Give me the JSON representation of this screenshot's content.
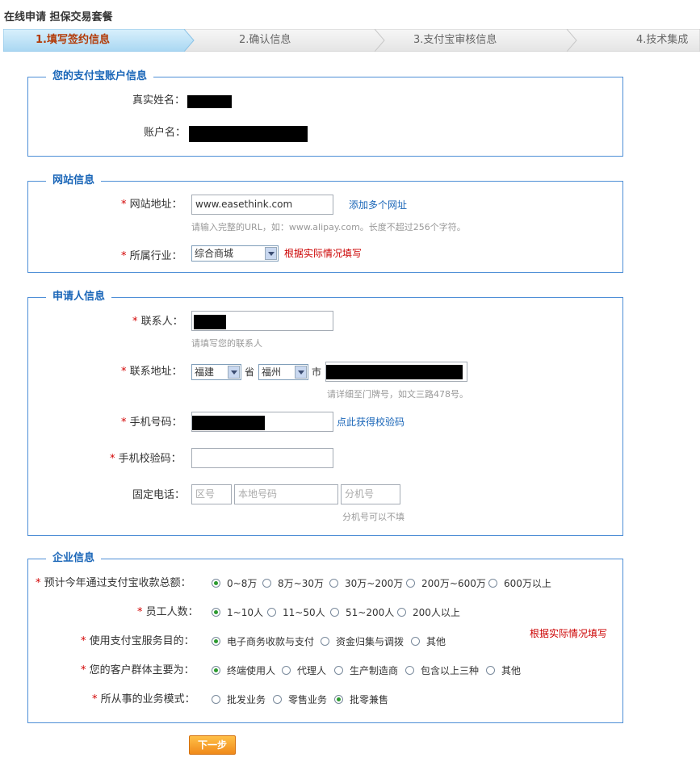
{
  "page": {
    "title": "在线申请 担保交易套餐"
  },
  "steps": [
    {
      "label": "1.填写签约信息"
    },
    {
      "label": "2.确认信息"
    },
    {
      "label": "3.支付宝审核信息"
    },
    {
      "label": "4.技术集成"
    }
  ],
  "account": {
    "legend": "您的支付宝账户信息",
    "realname_label": "真实姓名：",
    "account_label": "账户名："
  },
  "site": {
    "legend": "网站信息",
    "url_label": "网站地址：",
    "url_value": "www.easethink.com",
    "add_more": "添加多个网址",
    "url_hint": "请输入完整的URL，如：www.alipay.com。长度不超过256个字符。",
    "industry_label": "所属行业：",
    "industry_value": "综合商城",
    "industry_note": "根据实际情况填写"
  },
  "applicant": {
    "legend": "申请人信息",
    "contact_label": "联系人：",
    "contact_hint": "请填写您的联系人",
    "address_label": "联系地址：",
    "province_value": "福建",
    "province_suffix": "省",
    "city_value": "福州",
    "city_suffix": "市",
    "address_hint": "请详细至门牌号，如文三路478号。",
    "mobile_label": "手机号码：",
    "get_code": "点此获得校验码",
    "code_label": "手机校验码：",
    "phone_label": "固定电话：",
    "area_placeholder": "区号",
    "local_placeholder": "本地号码",
    "ext_placeholder": "分机号",
    "ext_hint": "分机号可以不填"
  },
  "company": {
    "legend": "企业信息",
    "note": "根据实际情况填写",
    "groups": [
      {
        "label": "预计今年通过支付宝收款总额：",
        "options": [
          "0~8万",
          "8万~30万",
          "30万~200万",
          "200万~600万",
          "600万以上"
        ],
        "selected": 0
      },
      {
        "label": "员工人数：",
        "options": [
          "1~10人",
          "11~50人",
          "51~200人",
          "200人以上"
        ],
        "selected": 0
      },
      {
        "label": "使用支付宝服务目的：",
        "options": [
          "电子商务收款与支付",
          "资金归集与调拨",
          "其他"
        ],
        "selected": 0
      },
      {
        "label": "您的客户群体主要为：",
        "options": [
          "终端使用人",
          "代理人",
          "生产制造商",
          "包含以上三种",
          "其他"
        ],
        "selected": 0
      },
      {
        "label": "所从事的业务模式：",
        "options": [
          "批发业务",
          "零售业务",
          "批零兼售"
        ],
        "selected": 2
      }
    ]
  },
  "actions": {
    "next": "下一步"
  },
  "colors": {
    "border": "#4d8ed6",
    "legend": "#1a66b8",
    "required": "#d20000",
    "active_step_bg": "#bfe2f7",
    "active_step_text": "#b23a06"
  }
}
